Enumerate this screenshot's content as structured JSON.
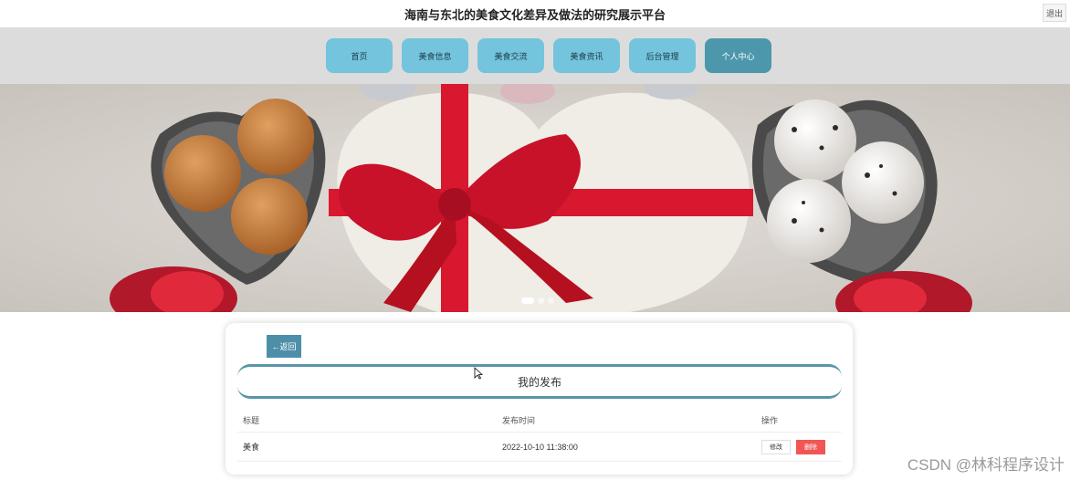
{
  "header": {
    "site_title": "海南与东北的美食文化差异及做法的研究展示平台",
    "logout_label": "退出"
  },
  "nav": {
    "items": [
      {
        "label": "首页"
      },
      {
        "label": "美食信息"
      },
      {
        "label": "美食交流"
      },
      {
        "label": "美食资讯"
      },
      {
        "label": "后台管理"
      },
      {
        "label": "个人中心"
      }
    ],
    "active_index": 5
  },
  "banner": {
    "slide_count": 3,
    "active_slide": 0
  },
  "panel": {
    "back_label": "←返回",
    "section_title": "我的发布",
    "columns": {
      "title": "标题",
      "time": "发布时间",
      "actions": "操作"
    },
    "rows": [
      {
        "title": "美食",
        "time": "2022-10-10 11:38:00",
        "edit_label": "修改",
        "delete_label": "删除"
      }
    ]
  },
  "watermark": "CSDN @林科程序设计",
  "colors": {
    "nav_button": "#73c4dc",
    "nav_active": "#4d97ad",
    "back_button": "#4d8fa8",
    "delete_button": "#f05656"
  }
}
